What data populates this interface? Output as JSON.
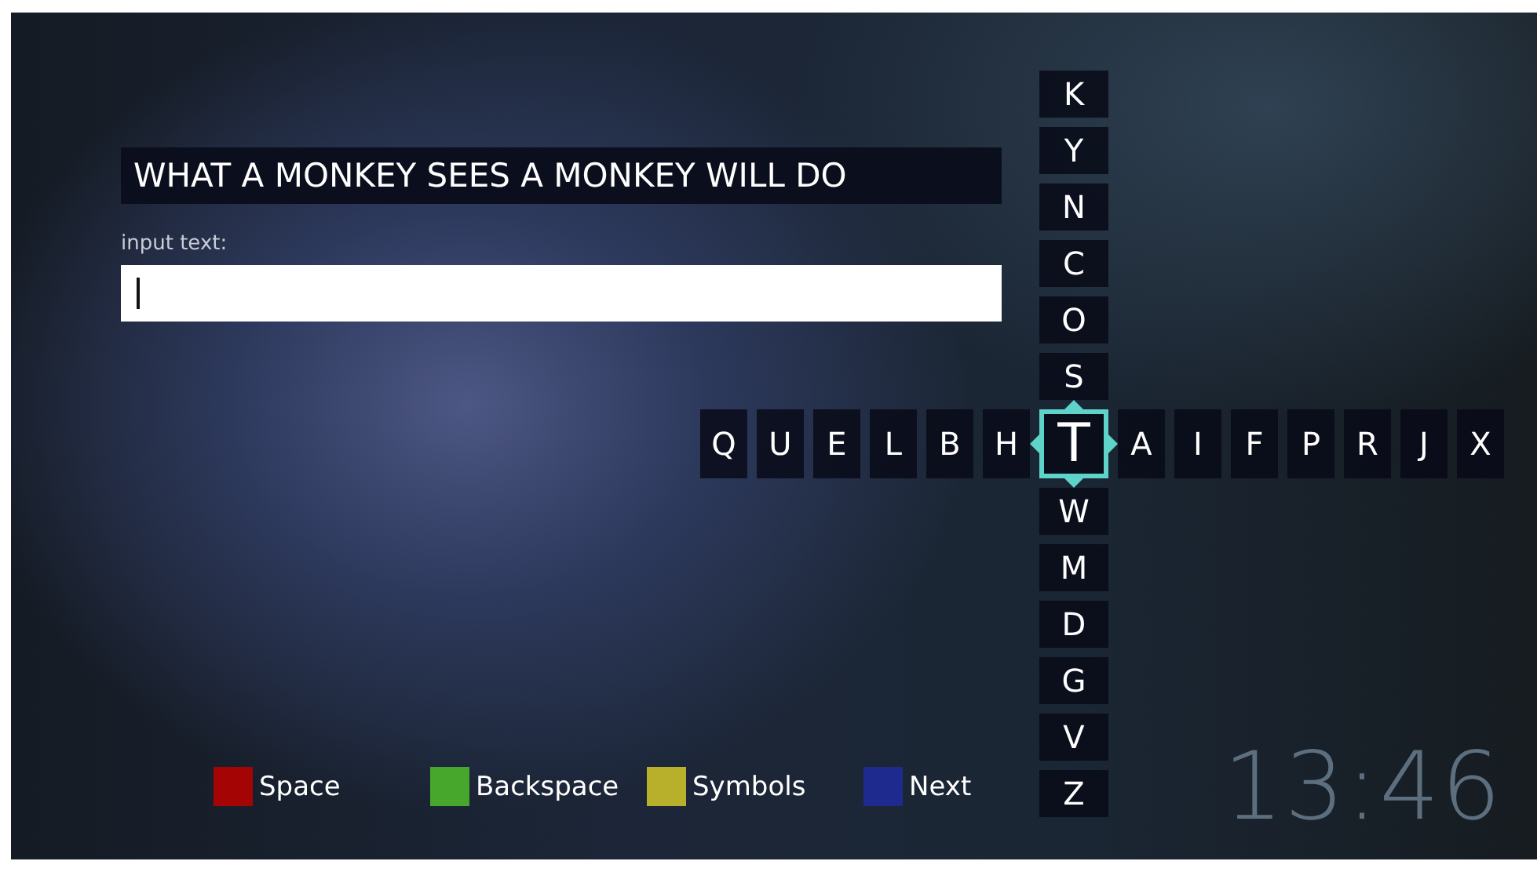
{
  "prompt": {
    "text": "WHAT A MONKEY SEES A MONKEY WILL DO"
  },
  "input": {
    "label": "input text:"
  },
  "keyboard": {
    "keys_above": [
      "K",
      "Y",
      "N",
      "C",
      "O",
      "S"
    ],
    "keys_left": [
      "Q",
      "U",
      "E",
      "L",
      "B",
      "H"
    ],
    "center_key": "T",
    "keys_right": [
      "A",
      "I",
      "F",
      "P",
      "R",
      "J",
      "X"
    ],
    "keys_below": [
      "W",
      "M",
      "D",
      "G",
      "V",
      "Z"
    ]
  },
  "legend": [
    {
      "label": "Space",
      "color": "#a50404"
    },
    {
      "label": "Backspace",
      "color": "#46a72c"
    },
    {
      "label": "Symbols",
      "color": "#b8b02a"
    },
    {
      "label": "Next",
      "color": "#1e2a8e"
    }
  ],
  "clock": "13:46"
}
